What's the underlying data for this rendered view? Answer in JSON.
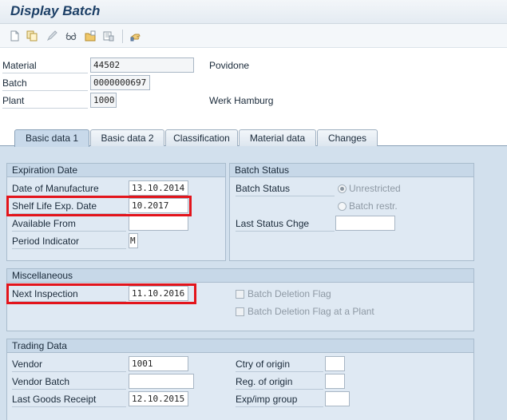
{
  "title": "Display Batch",
  "toolbar": {
    "icons": [
      "create-icon",
      "copy-icon",
      "change-icon",
      "glasses-icon",
      "folder-icon",
      "delete-icon",
      "hand-icon"
    ]
  },
  "header": {
    "material_label": "Material",
    "material_value": "44502",
    "material_desc": "Povidone",
    "batch_label": "Batch",
    "batch_value": "0000000697",
    "plant_label": "Plant",
    "plant_value": "1000",
    "plant_desc": "Werk Hamburg"
  },
  "tabs": [
    "Basic data 1",
    "Basic data 2",
    "Classification",
    "Material data",
    "Changes"
  ],
  "expiration": {
    "title": "Expiration Date",
    "dom_label": "Date of Manufacture",
    "dom_value": "13.10.2014",
    "sled_label": "Shelf Life Exp. Date",
    "sled_value": "10.2017",
    "avail_label": "Available From",
    "avail_value": "",
    "period_label": "Period Indicator",
    "period_value": "M"
  },
  "batch_status": {
    "title": "Batch Status",
    "status_label": "Batch Status",
    "unrestricted": "Unrestricted",
    "restricted": "Batch restr.",
    "last_change_label": "Last Status Chge",
    "last_change_value": ""
  },
  "misc": {
    "title": "Miscellaneous",
    "next_insp_label": "Next Inspection",
    "next_insp_value": "11.10.2016",
    "deletion_flag": "Batch Deletion Flag",
    "deletion_flag_plant": "Batch Deletion Flag at a Plant"
  },
  "trading": {
    "title": "Trading Data",
    "vendor_label": "Vendor",
    "vendor_value": "1001",
    "vendor_batch_label": "Vendor Batch",
    "vendor_batch_value": "",
    "last_gr_label": "Last Goods Receipt",
    "last_gr_value": "12.10.2015",
    "ctry_label": "Ctry of origin",
    "ctry_value": "",
    "reg_label": "Reg. of origin",
    "reg_value": "",
    "expimp_label": "Exp/imp group",
    "expimp_value": ""
  },
  "colors": {
    "highlight": "#e3141b",
    "panel": "#d2e0ed",
    "title": "#1c3f66"
  }
}
